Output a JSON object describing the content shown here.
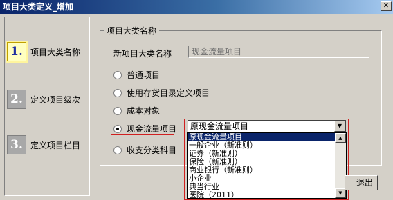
{
  "window": {
    "title": "项目大类定义_增加"
  },
  "steps": [
    {
      "number": "1.",
      "label": "项目大类名称",
      "active": true
    },
    {
      "number": "2.",
      "label": "定义项目级次",
      "active": false
    },
    {
      "number": "3.",
      "label": "定义项目栏目",
      "active": false
    }
  ],
  "group": {
    "legend": "项目大类名称",
    "new_label": "新项目大类名称",
    "new_value": "现金流量项目"
  },
  "options": [
    {
      "label": "普通项目",
      "checked": false
    },
    {
      "label": "使用存货目录定义项目",
      "checked": false
    },
    {
      "label": "成本对象",
      "checked": false
    },
    {
      "label": "现金流量项目",
      "checked": true
    },
    {
      "label": "收支分类科目",
      "checked": false
    }
  ],
  "combo": {
    "value": "原现金流量项目",
    "items": [
      "原现金流量项目",
      "一般企业（新准则）",
      "证券（新准则）",
      "保险（新准则）",
      "商业银行（新准则）",
      "小企业",
      "典当行业",
      "医院（2011）"
    ],
    "selected_index": 0
  },
  "buttons": {
    "exit": "退出"
  }
}
